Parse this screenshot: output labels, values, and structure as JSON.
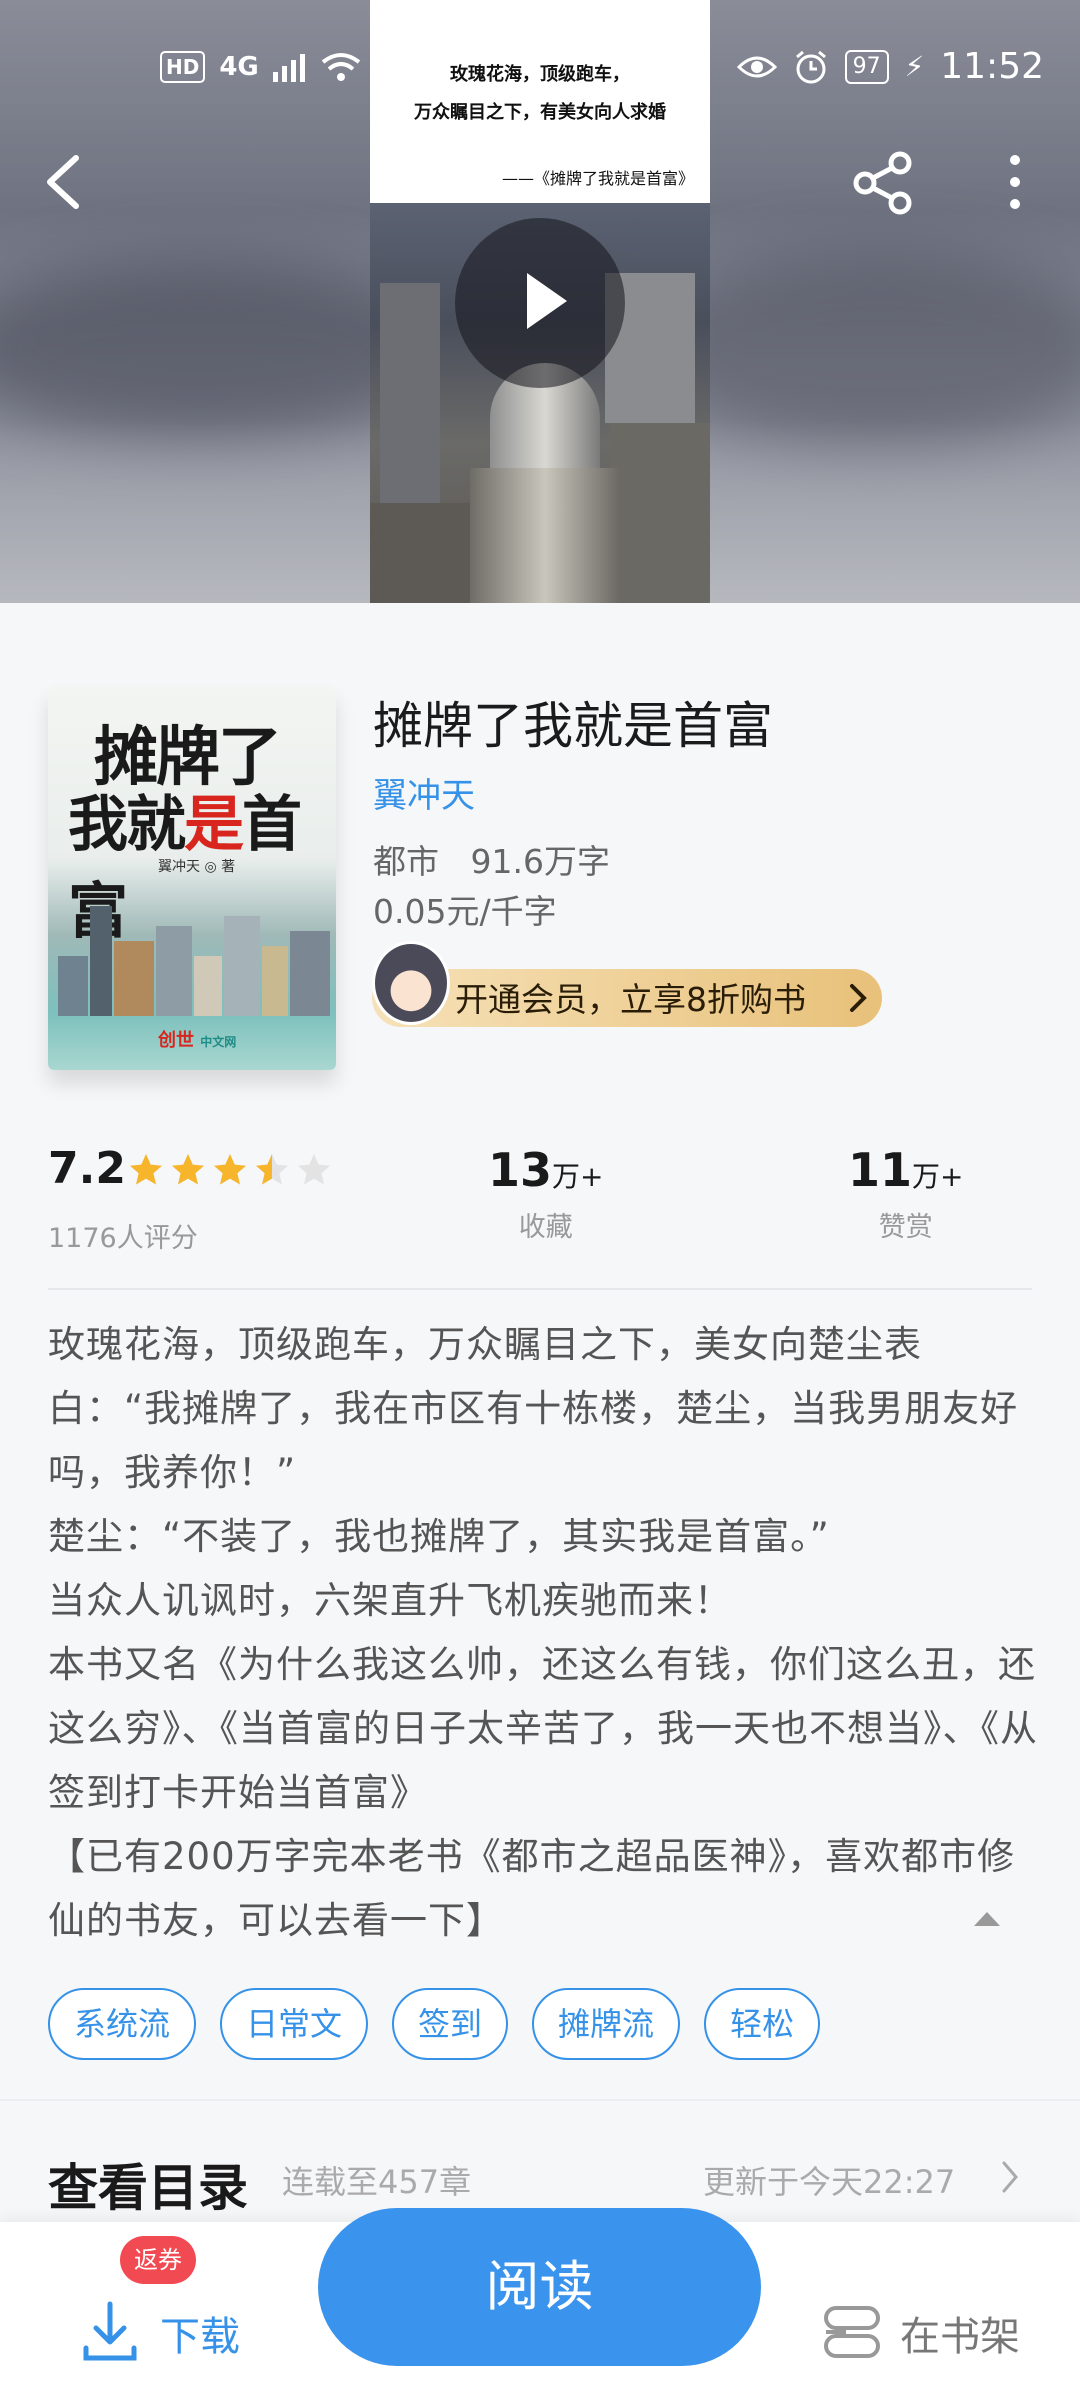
{
  "status_bar": {
    "network": "HD",
    "signal": "4G",
    "battery": "97",
    "time": "11:52"
  },
  "video": {
    "caption_line1": "玫瑰花海，顶级跑车，",
    "caption_line2": "万众瞩目之下，有美女向人求婚",
    "caption_source": "——《摊牌了我就是首富》"
  },
  "book": {
    "cover_title_line1": "摊牌了",
    "cover_title_line2_a": "我就",
    "cover_title_line2_b": "是",
    "cover_title_line2_c": "首富",
    "cover_author": "翼冲天 ◎ 著",
    "cover_publisher": "创世",
    "cover_publisher_sub": "中文网",
    "title": "摊牌了我就是首富",
    "author": "翼冲天",
    "category": "都市",
    "word_count": "91.6万字",
    "price": "0.05元/千字",
    "vip_promo": "开通会员，立享8折购书"
  },
  "stats": {
    "rating": "7.2",
    "rating_value": 3.5,
    "rating_max": 5,
    "rating_count": "1176人评分",
    "favorites_num": "13",
    "favorites_unit": "万+",
    "favorites_label": "收藏",
    "rewards_num": "11",
    "rewards_unit": "万+",
    "rewards_label": "赞赏"
  },
  "description": "玫瑰花海，顶级跑车，万众瞩目之下，美女向楚尘表白：“我摊牌了，我在市区有十栋楼，楚尘，当我男朋友好吗，我养你！”\n楚尘：“不装了，我也摊牌了，其实我是首富。”\n当众人讥讽时，六架直升飞机疾驰而来！\n本书又名《为什么我这么帅，还这么有钱，你们这么丑，还这么穷》、《当首富的日子太辛苦了，我一天也不想当》、《从签到打卡开始当首富》\n【已有200万字完本老书《都市之超品医神》，喜欢都市修仙的书友，可以去看一下】",
  "tags": [
    "系统流",
    "日常文",
    "签到",
    "摊牌流",
    "轻松"
  ],
  "toc": {
    "title": "查看目录",
    "status": "连载至457章",
    "updated": "更新于今天22:27"
  },
  "bottom_bar": {
    "coupon_badge": "返券",
    "download_label": "下载",
    "read_label": "阅读",
    "shelf_label": "在书架"
  },
  "colors": {
    "accent": "#3592e8",
    "star": "#f7b52c",
    "coupon": "#f24a52"
  }
}
